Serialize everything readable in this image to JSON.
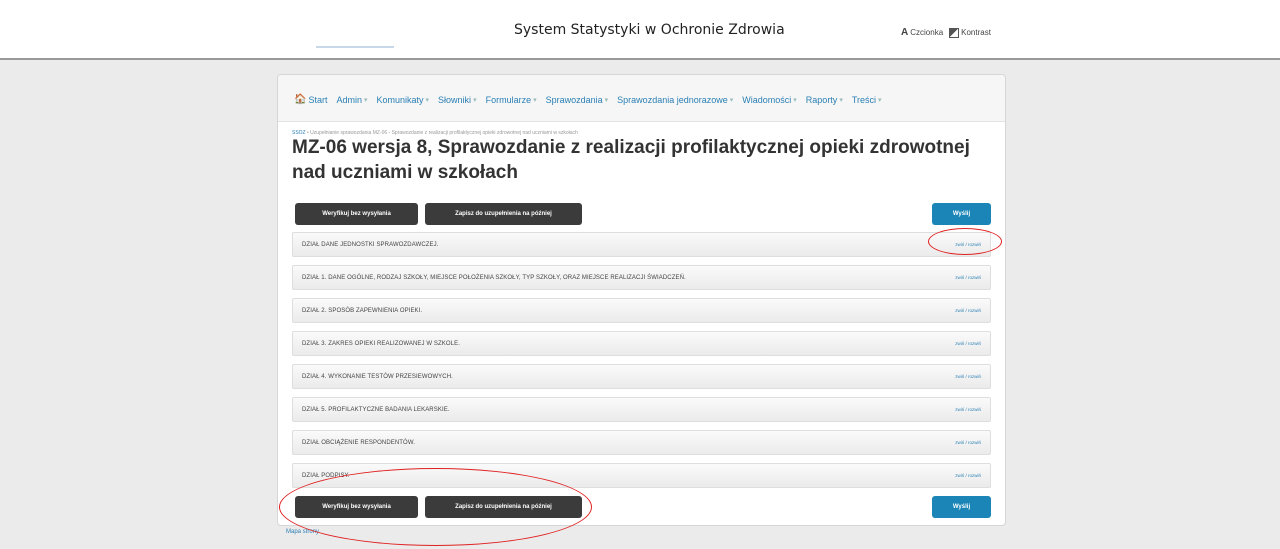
{
  "header": {
    "site_title": "System Statystyki w Ochronie Zdrowia",
    "font_tool_label": "Czcionka",
    "contrast_tool_label": "Kontrast"
  },
  "nav": {
    "items": [
      {
        "label": "Start",
        "icon": "home-icon",
        "has_dropdown": false
      },
      {
        "label": "Admin",
        "has_dropdown": true
      },
      {
        "label": "Komunikaty",
        "has_dropdown": true
      },
      {
        "label": "Słowniki",
        "has_dropdown": true
      },
      {
        "label": "Formularze",
        "has_dropdown": true
      },
      {
        "label": "Sprawozdania",
        "has_dropdown": true
      },
      {
        "label": "Sprawozdania jednorazowe",
        "has_dropdown": true
      },
      {
        "label": "Wiadomości",
        "has_dropdown": true
      },
      {
        "label": "Raporty",
        "has_dropdown": true
      },
      {
        "label": "Treści",
        "has_dropdown": true
      }
    ],
    "caret": "▾"
  },
  "breadcrumb": {
    "home": "SSOZ",
    "separator": "•",
    "path": "Uzupełnianie sprawozdania MZ-06 - Sprawozdanie z realizacji profilaktycznej opieki zdrowotnej nad uczniami w szkołach"
  },
  "page": {
    "title": "MZ-06 wersja 8, Sprawozdanie z realizacji profilaktycznej opieki zdrowotnej nad uczniami w szkołach"
  },
  "actions": {
    "verify_label": "Weryfikuj bez wysyłania",
    "save_label": "Zapisz do uzupełnienia na później",
    "send_label": "Wyślij"
  },
  "sections": [
    {
      "label": "DZIAŁ DANE JEDNOSTKI SPRAWOZDAWCZEJ.",
      "toggle": "zwiń / rozwiń"
    },
    {
      "label": "DZIAŁ 1. DANE OGÓLNE, RODZAJ SZKOŁY, MIEJSCE POŁOŻENIA SZKOŁY, TYP SZKOŁY, ORAZ MIEJSCE REALIZACJI ŚWIADCZEŃ.",
      "toggle": "zwiń / rozwiń"
    },
    {
      "label": "DZIAŁ 2. SPOSÓB ZAPEWNIENIA OPIEKI.",
      "toggle": "zwiń / rozwiń"
    },
    {
      "label": "DZIAŁ 3. ZAKRES OPIEKI REALIZOWANEJ W SZKOLE.",
      "toggle": "zwiń / rozwiń"
    },
    {
      "label": "DZIAŁ 4. WYKONANIE TESTÓW PRZESIEWOWYCH.",
      "toggle": "zwiń / rozwiń"
    },
    {
      "label": "DZIAŁ 5. PROFILAKTYCZNE BADANIA LEKARSKIE.",
      "toggle": "zwiń / rozwiń"
    },
    {
      "label": "DZIAŁ OBCIĄŻENIE RESPONDENTÓW.",
      "toggle": "zwiń / rozwiń"
    },
    {
      "label": "DZIAŁ PODPISY.",
      "toggle": "zwiń / rozwiń"
    }
  ],
  "footer": {
    "sitemap_label": "Mapa strony"
  },
  "colors": {
    "accent": "#1a85b6",
    "dark_button": "#3b3b3b",
    "annotation": "#e02020"
  }
}
